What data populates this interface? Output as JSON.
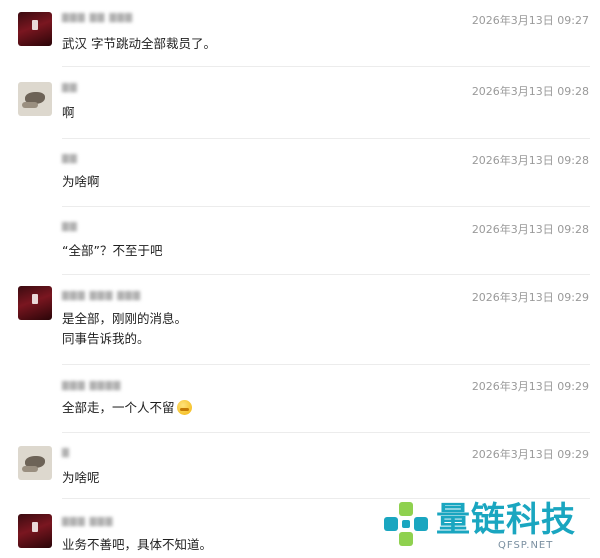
{
  "messages": [
    {
      "name": "",
      "time": "2026年3月13日 09:27",
      "lines": [
        "武汉 字节跳动全部裁员了。"
      ]
    },
    {
      "name": "",
      "time": "2026年3月13日 09:28",
      "lines": [
        "啊"
      ]
    },
    {
      "name": "",
      "time": "2026年3月13日 09:28",
      "lines": [
        "为啥啊"
      ]
    },
    {
      "name": "",
      "time": "2026年3月13日 09:28",
      "lines": [
        "“全部”？不至于吧"
      ]
    },
    {
      "name": "",
      "time": "2026年3月13日 09:29",
      "lines": [
        "是全部，刚刚的消息。",
        "同事告诉我的。"
      ]
    },
    {
      "name": "",
      "time": "2026年3月13日 09:29",
      "lines": [
        "全部走，一个人不留"
      ]
    },
    {
      "name": "",
      "time": "2026年3月13日 09:29",
      "lines": [
        "为啥呢"
      ]
    },
    {
      "name": "",
      "time": "",
      "lines": [
        "业务不善吧，具体不知道。"
      ]
    }
  ],
  "watermark": {
    "brand": "量链科技",
    "domain": "QFSP.NET"
  },
  "colors": {
    "accent": "#1aa6c0",
    "time": "#9a9a9a",
    "divider": "#ececec"
  }
}
